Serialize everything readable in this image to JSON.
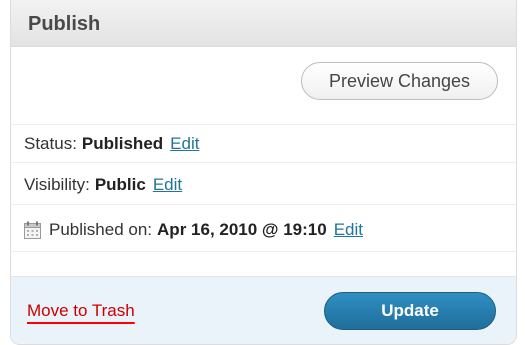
{
  "publish_box": {
    "title": "Publish",
    "preview_button": "Preview Changes",
    "status": {
      "label": "Status:",
      "value": "Published",
      "edit": "Edit"
    },
    "visibility": {
      "label": "Visibility:",
      "value": "Public",
      "edit": "Edit"
    },
    "published_on": {
      "label": "Published on:",
      "value": "Apr 16, 2010 @ 19:10",
      "edit": "Edit",
      "icon": "calendar-icon"
    },
    "trash_link": "Move to Trash",
    "update_button": "Update"
  },
  "colors": {
    "link": "#21759b",
    "trash": "#cc0000",
    "update_button": "#2581b3",
    "footer_bg": "#eaf2fa"
  }
}
